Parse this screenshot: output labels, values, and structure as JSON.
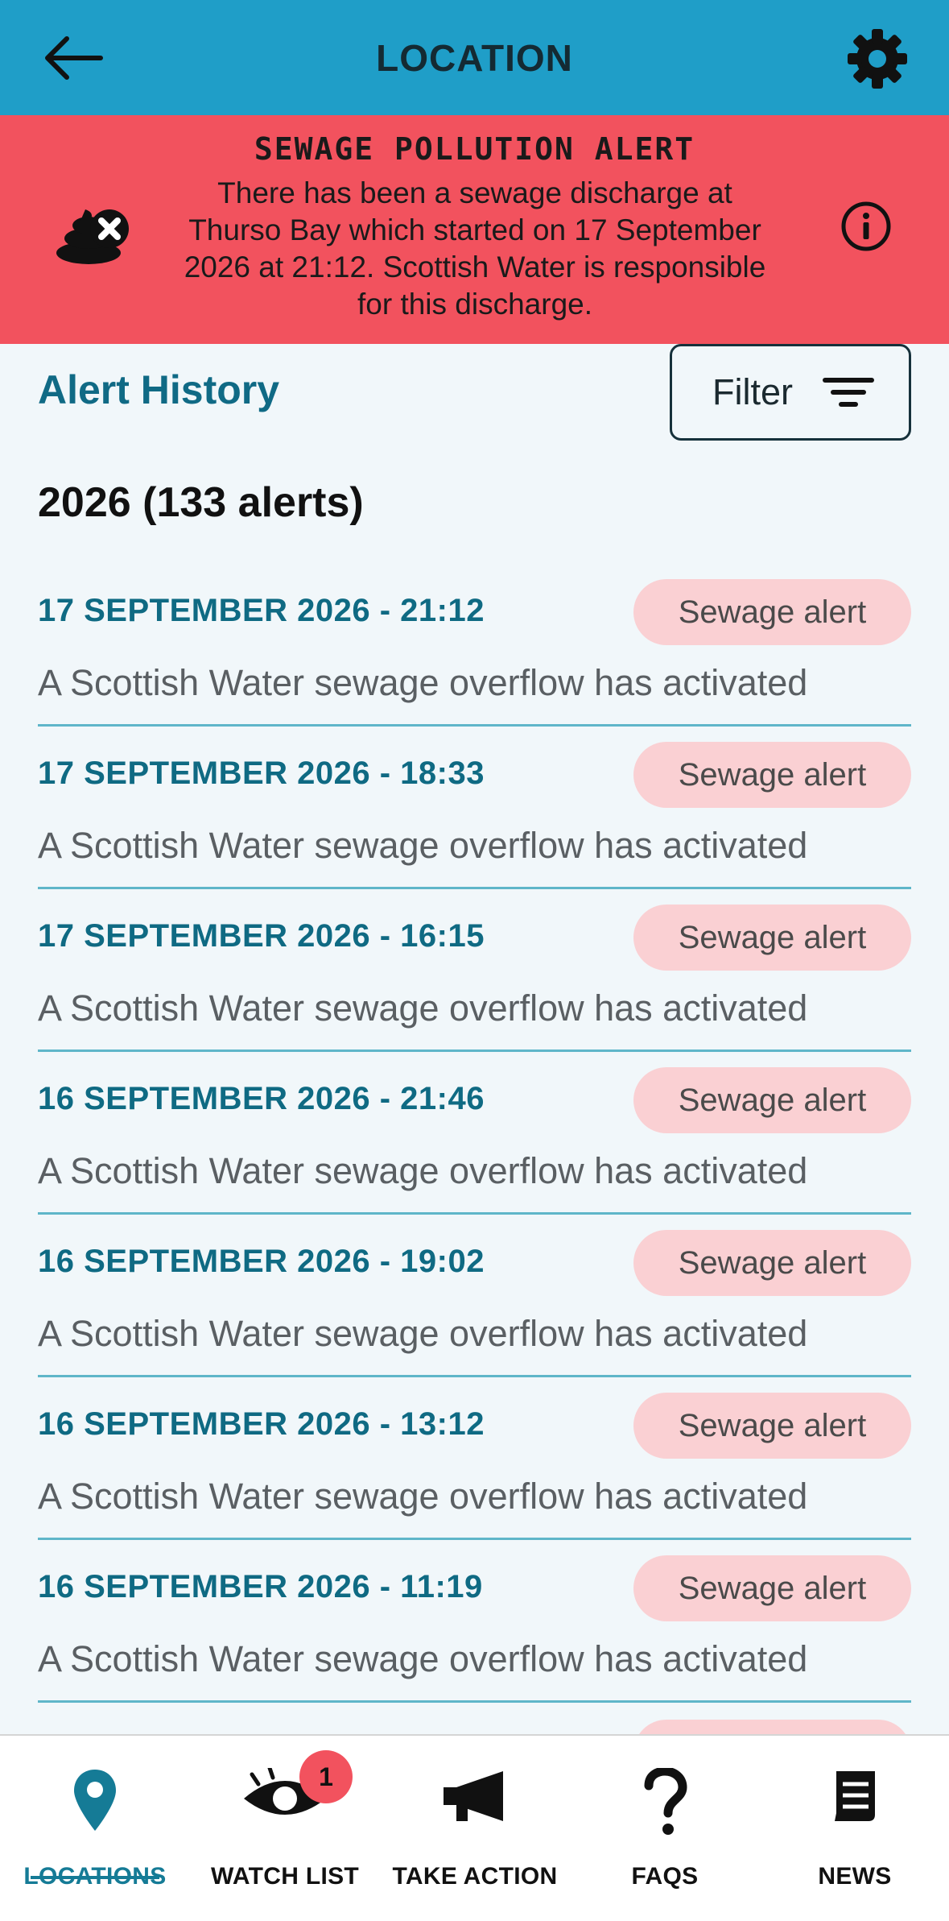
{
  "header": {
    "title": "LOCATION",
    "back_icon": "arrow-left-icon",
    "settings_icon": "gear-icon",
    "background": "#1f9ec8"
  },
  "alert_banner": {
    "title": "SEWAGE POLLUTION ALERT",
    "message": "There has been a sewage discharge at Thurso Bay which started on 17 September 2026 at 21:12. Scottish Water is responsible for this discharge.",
    "icon": "poo-x-icon",
    "info_icon": "info-icon",
    "background": "#f2525e"
  },
  "history": {
    "title": "Alert History",
    "filter_label": "Filter",
    "filter_icon": "filter-lines-icon",
    "year_heading": "2026 (133 alerts)"
  },
  "alerts": [
    {
      "date": "17 SEPTEMBER 2026 - 21:12",
      "badge": "Sewage alert",
      "description": "A Scottish Water sewage overflow has activated"
    },
    {
      "date": "17 SEPTEMBER 2026 - 18:33",
      "badge": "Sewage alert",
      "description": "A Scottish Water sewage overflow has activated"
    },
    {
      "date": "17 SEPTEMBER 2026 - 16:15",
      "badge": "Sewage alert",
      "description": "A Scottish Water sewage overflow has activated"
    },
    {
      "date": "16 SEPTEMBER 2026 - 21:46",
      "badge": "Sewage alert",
      "description": "A Scottish Water sewage overflow has activated"
    },
    {
      "date": "16 SEPTEMBER 2026 - 19:02",
      "badge": "Sewage alert",
      "description": "A Scottish Water sewage overflow has activated"
    },
    {
      "date": "16 SEPTEMBER 2026 - 13:12",
      "badge": "Sewage alert",
      "description": "A Scottish Water sewage overflow has activated"
    },
    {
      "date": "16 SEPTEMBER 2026 - 11:19",
      "badge": "Sewage alert",
      "description": "A Scottish Water sewage overflow has activated"
    }
  ],
  "nav": {
    "items": [
      {
        "label": "LOCATIONS",
        "icon": "map-pin-icon",
        "active": true
      },
      {
        "label": "WATCH LIST",
        "icon": "eye-icon",
        "badge": "1"
      },
      {
        "label": "TAKE ACTION",
        "icon": "megaphone-icon"
      },
      {
        "label": "FAQS",
        "icon": "question-mark-icon"
      },
      {
        "label": "NEWS",
        "icon": "document-icon"
      }
    ],
    "active_color": "#157b96"
  }
}
